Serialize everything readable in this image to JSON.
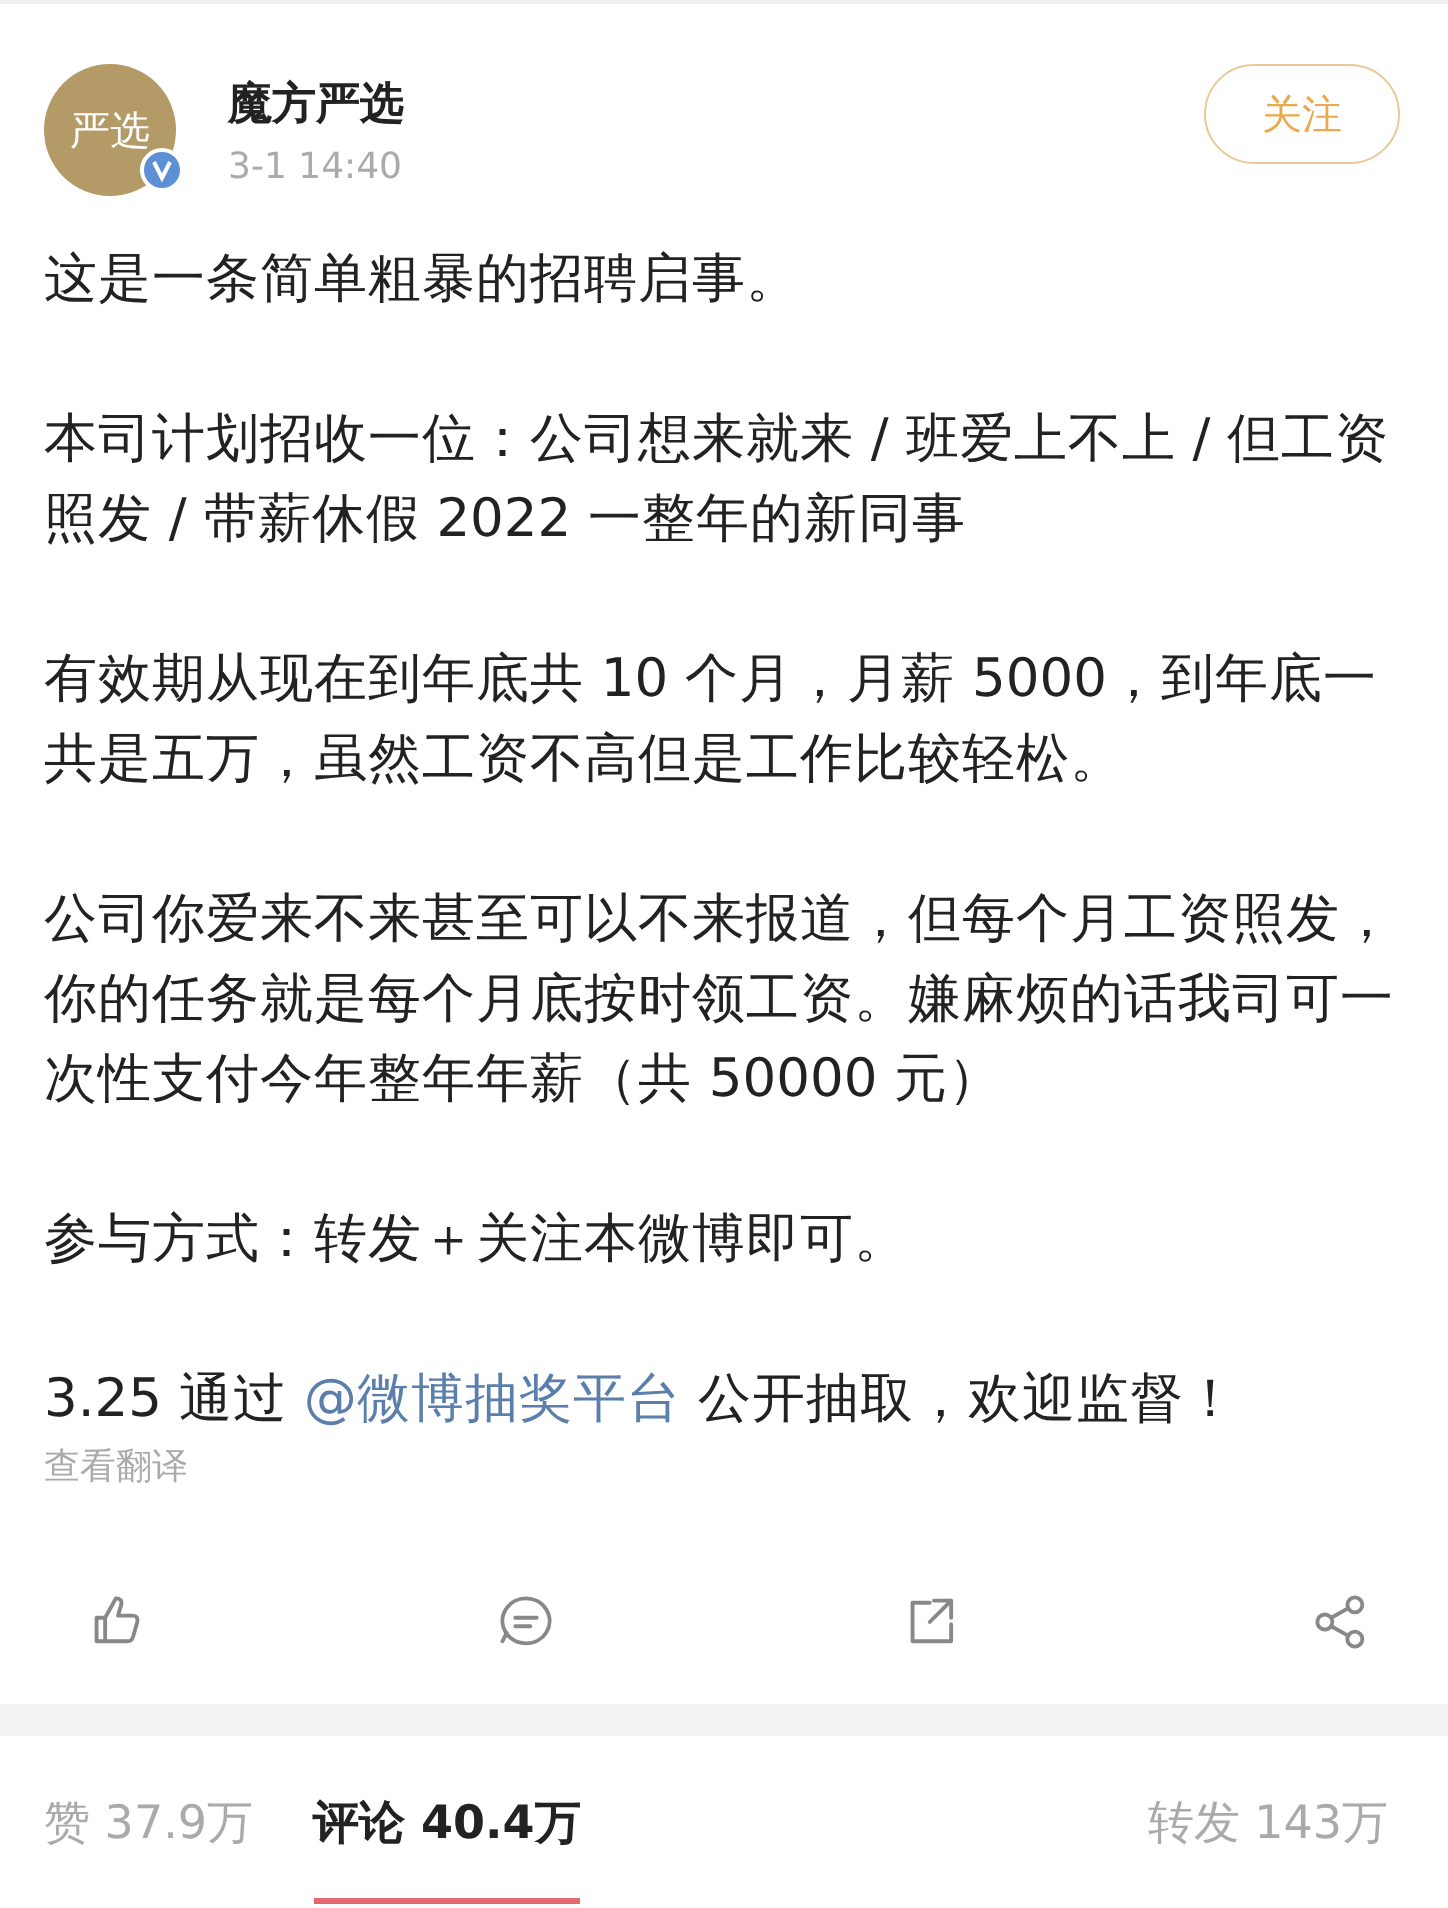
{
  "author": {
    "avatar_text": "严选",
    "name": "魔方严选",
    "verified": true,
    "time": "3-1 14:40",
    "follow_button": "关注"
  },
  "paragraphs": [
    [
      {
        "text": "这是一条简单粗暴的招聘启事。"
      }
    ],
    [
      {
        "text": "本司计划招收一位：公司想来就来 / 班爱上不上 / 但工资照发 / 带薪休假 2022 一整年的新同事"
      }
    ],
    [
      {
        "text": "有效期从现在到年底共 10 个月，月薪 5000，到年底一共是五万，虽然工资不高但是工作比较轻松。"
      }
    ],
    [
      {
        "text": "公司你爱来不来甚至可以不来报道，但每个月工资照发，你的任务就是每个月底按时领工资。嫌麻烦的话我司可一次性支付今年整年年薪（共 50000 元）"
      }
    ],
    [
      {
        "text": "参与方式：转发＋关注本微博即可。"
      }
    ],
    [
      {
        "text": "3.25 通过 "
      },
      {
        "text": "@微博抽奖平台",
        "kind": "link"
      },
      {
        "text": " 公开抽取，欢迎监督！"
      }
    ]
  ],
  "translate_link": "查看翻译",
  "actions": [
    {
      "kind": "like"
    },
    {
      "kind": "comment"
    },
    {
      "kind": "repost"
    },
    {
      "kind": "share"
    }
  ],
  "tabs": [
    {
      "label": "赞 37.9万",
      "selected": false
    },
    {
      "label": "评论 40.4万",
      "selected": true
    },
    {
      "label": "转发 143万",
      "selected": false
    }
  ]
}
